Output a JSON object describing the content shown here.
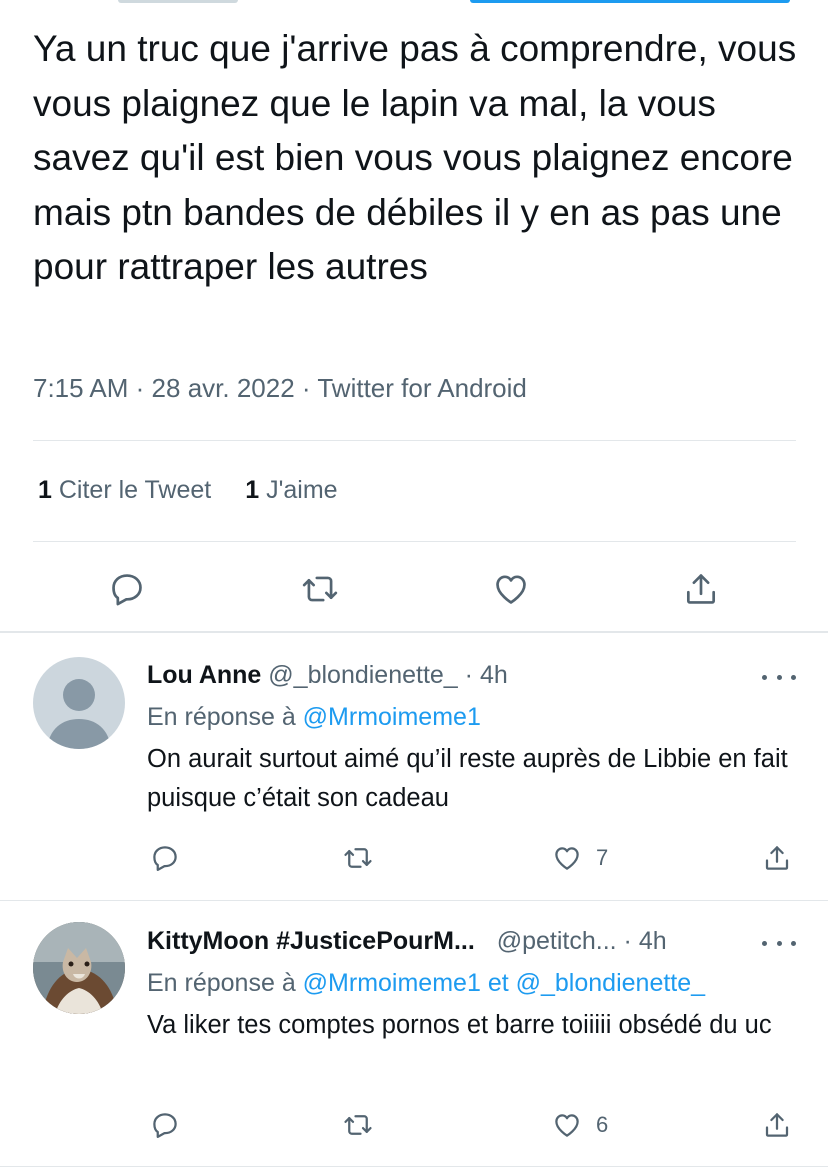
{
  "tweet": {
    "text": "Ya un truc que j'arrive pas à comprendre, vous vous plaignez que le lapin va mal, la vous savez qu'il est bien vous vous plaignez encore mais ptn bandes de débiles il y en as pas une pour rattraper les autres",
    "time": "7:15 AM",
    "date": "28 avr. 2022",
    "source": "Twitter for Android",
    "separator": "·",
    "quote_count": "1",
    "quote_label": "Citer le Tweet",
    "like_count": "1",
    "like_label": "J'aime"
  },
  "icons": {
    "reply": "reply-icon",
    "retweet": "retweet-icon",
    "like": "heart-icon",
    "share": "share-icon",
    "more": "more-icon"
  },
  "colors": {
    "text": "#0f1419",
    "secondary": "#536471",
    "accent": "#1d9bf0",
    "divider": "#e3e7ea"
  },
  "replies": [
    {
      "name": "Lou Anne",
      "handle": "@_blondienette_",
      "time": "4h",
      "reply_label": "En réponse à",
      "mention1": "@Mrmoimeme1",
      "and_label": "",
      "mention2": "",
      "text": "On aurait surtout aimé qu’il reste auprès de Libbie en fait puisque c’était son cadeau",
      "like_count": "7"
    },
    {
      "name": "KittyMoon #JusticePourM...",
      "handle": "@petitch...",
      "time": "4h",
      "reply_label": "En réponse à",
      "mention1": "@Mrmoimeme1",
      "and_label": "et",
      "mention2": "@_blondienette_",
      "text": "Va liker tes comptes pornos et barre toiiiii obsédé du uc",
      "like_count": "6"
    }
  ]
}
